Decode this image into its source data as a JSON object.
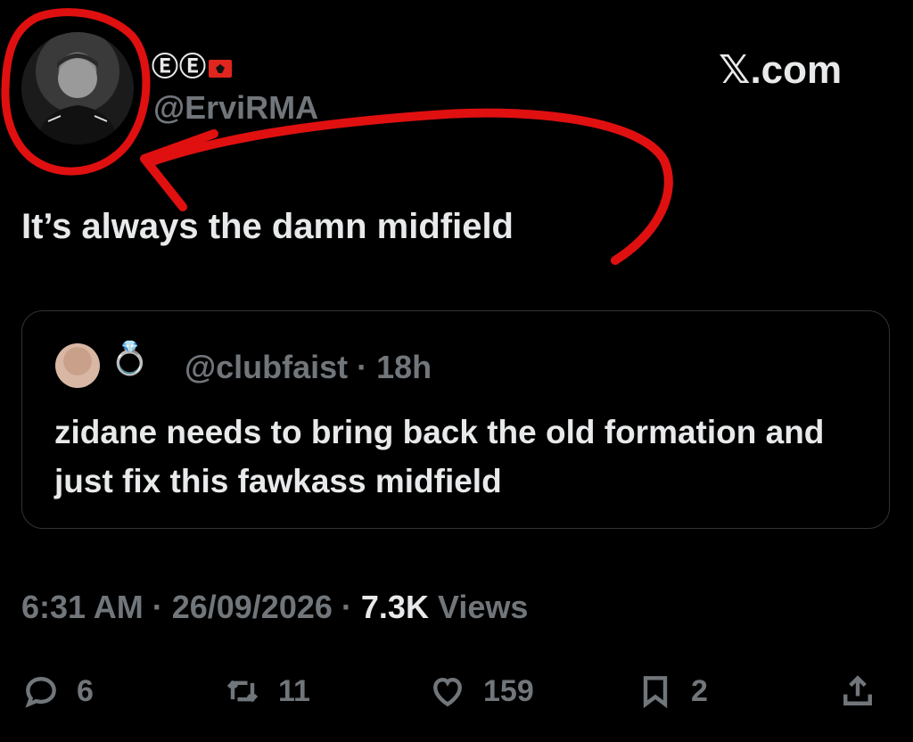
{
  "brand": "𝕏.com",
  "author": {
    "display_name": "ⒺⒺ",
    "handle": "@ErviRMA"
  },
  "tweet": {
    "text": "It’s always the damn midfield",
    "time": "6:31 AM",
    "date": "26/09/2026",
    "views_count": "7.3K",
    "views_label": "Views"
  },
  "quote": {
    "ring": "💍",
    "handle": "@clubfaist",
    "age": "18h",
    "text": "zidane needs to bring back the old formation and just fix this fawkass midfield"
  },
  "actions": {
    "replies": "6",
    "retweets": "11",
    "likes": "159",
    "bookmarks": "2"
  },
  "colors": {
    "background": "#000000",
    "text": "#e7e9ea",
    "muted": "#71767b",
    "annotation": "#e01010"
  }
}
